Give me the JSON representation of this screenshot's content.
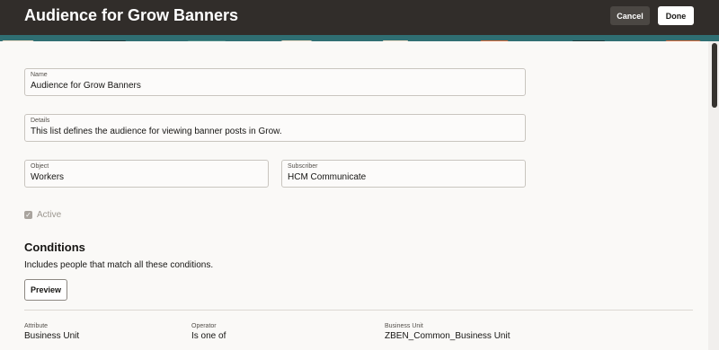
{
  "header": {
    "title": "Audience for Grow Banners",
    "cancel_label": "Cancel",
    "done_label": "Done"
  },
  "form": {
    "name": {
      "label": "Name",
      "value": "Audience for Grow Banners"
    },
    "details": {
      "label": "Details",
      "value": "This list defines the audience for viewing banner posts in Grow."
    },
    "object": {
      "label": "Object",
      "value": "Workers"
    },
    "subscriber": {
      "label": "Subscriber",
      "value": "HCM Communicate"
    },
    "active": {
      "label": "Active",
      "checked": true
    }
  },
  "conditions": {
    "title": "Conditions",
    "description": "Includes people that match all these conditions.",
    "preview_label": "Preview",
    "columns": {
      "attribute": {
        "label": "Attribute",
        "value": "Business Unit"
      },
      "operator": {
        "label": "Operator",
        "value": "Is one of"
      },
      "business_unit": {
        "label": "Business Unit",
        "value": "ZBEN_Common_Business Unit"
      }
    }
  },
  "colors": {
    "header_bg": "#312d2a",
    "page_bg": "#faf9f7",
    "accent_banner": "#2f6e72"
  }
}
